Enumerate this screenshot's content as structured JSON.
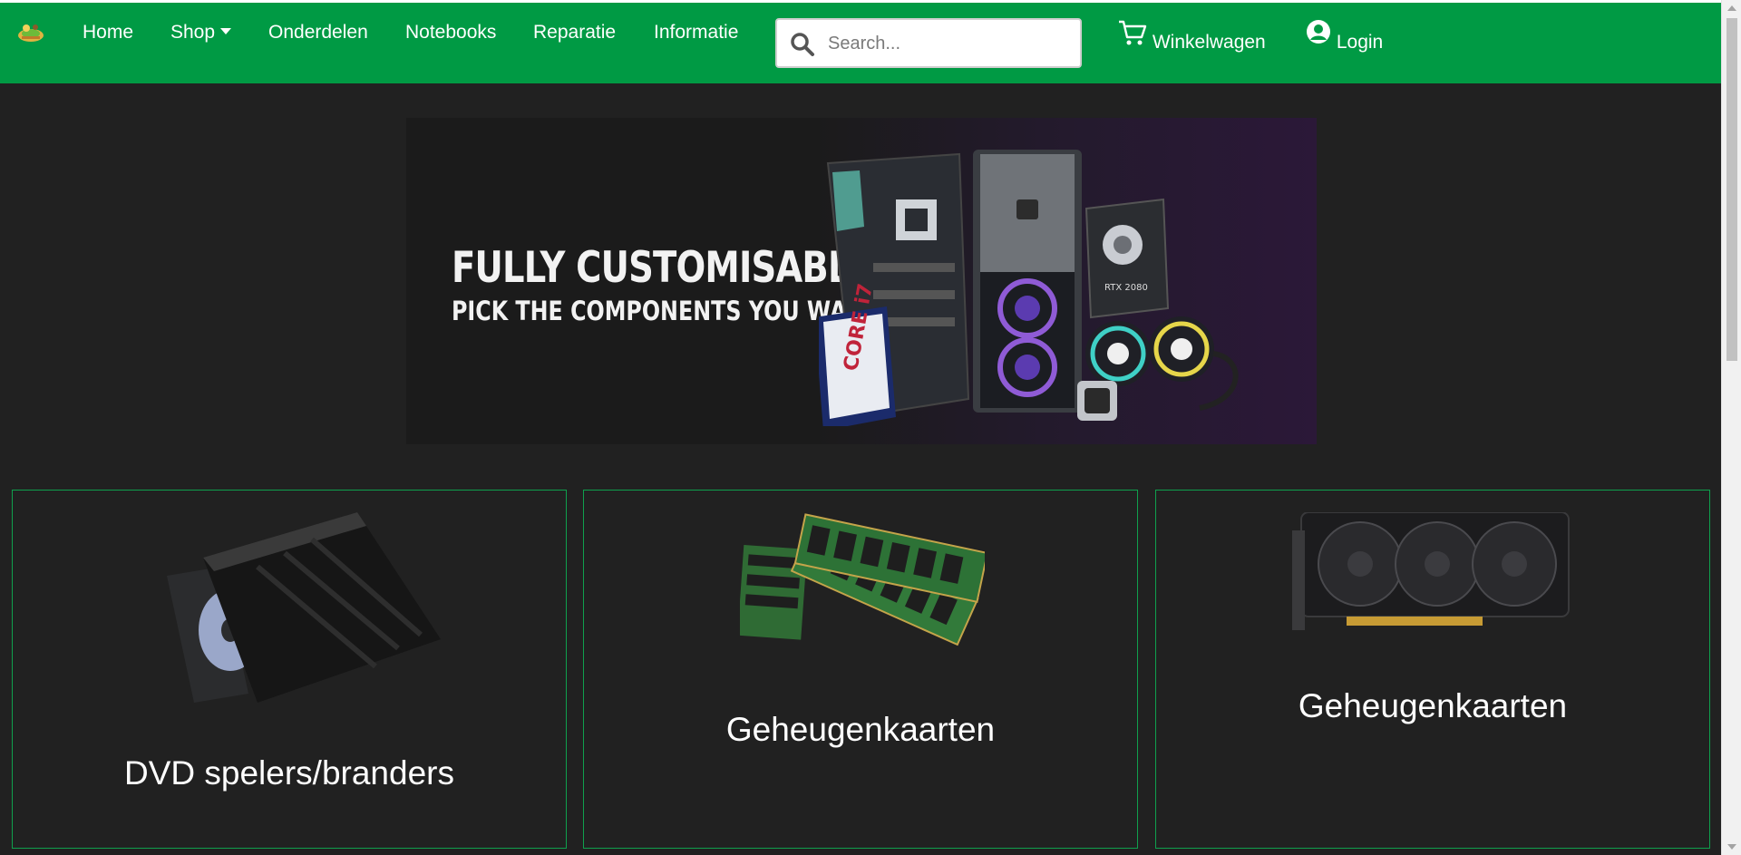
{
  "nav": {
    "items": [
      {
        "label": "Home"
      },
      {
        "label": "Shop"
      },
      {
        "label": "Onderdelen"
      },
      {
        "label": "Notebooks"
      },
      {
        "label": "Reparatie"
      },
      {
        "label": "Informatie"
      }
    ],
    "search": {
      "placeholder": "Search..."
    },
    "cart_label": "Winkelwagen",
    "login_label": "Login"
  },
  "banner": {
    "title": "FULLY CUSTOMISABLE",
    "subtitle": "PICK THE COMPONENTS YOU WANT",
    "gpu_label": "RTX 2080",
    "cpu_label": "CORE i7"
  },
  "categories": [
    {
      "title": "DVD spelers/branders",
      "image": "dvd-drive"
    },
    {
      "title": "Geheugenkaarten",
      "image": "ram-modules"
    },
    {
      "title": "Geheugenkaarten",
      "image": "graphics-card"
    }
  ],
  "colors": {
    "nav_bg": "#009a44",
    "page_bg": "#212121",
    "card_border": "#0fa04d"
  }
}
